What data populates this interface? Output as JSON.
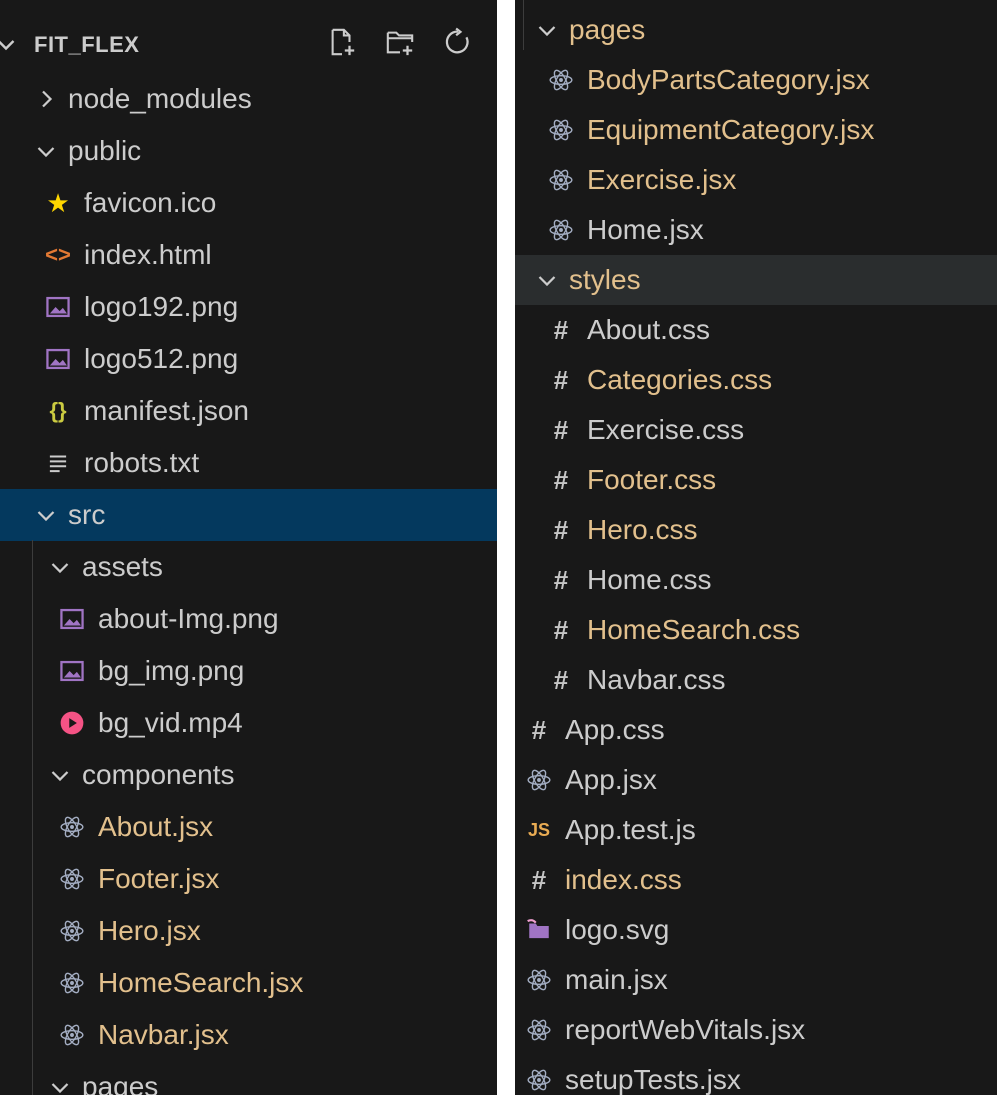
{
  "colors": {
    "background": "#181818",
    "text": "#cccccc",
    "modified": "#e2c08d",
    "selected": "#04395e",
    "hover": "#2a2d2e",
    "react": "#a3adc2",
    "hash": "#c5c5c5",
    "image": "#a074c4",
    "html": "#e37933",
    "json": "#cbcb41",
    "video": "#f55385",
    "js": "#e8ab53",
    "star": "#ffd700"
  },
  "explorer": {
    "root_title": "FIT_FLEX",
    "toolbar": [
      {
        "name": "new-file-button",
        "icon": "new-file-icon"
      },
      {
        "name": "new-folder-button",
        "icon": "new-folder-icon"
      },
      {
        "name": "refresh-explorer-button",
        "icon": "refresh-icon"
      }
    ],
    "left": [
      {
        "label": "node_modules",
        "kind": "folder",
        "expanded": false,
        "depth": 0
      },
      {
        "label": "public",
        "kind": "folder",
        "expanded": true,
        "depth": 0
      },
      {
        "label": "favicon.ico",
        "kind": "file",
        "icon": "star",
        "depth": 1
      },
      {
        "label": "index.html",
        "kind": "file",
        "icon": "html",
        "depth": 1
      },
      {
        "label": "logo192.png",
        "kind": "file",
        "icon": "image",
        "depth": 1
      },
      {
        "label": "logo512.png",
        "kind": "file",
        "icon": "image",
        "depth": 1
      },
      {
        "label": "manifest.json",
        "kind": "file",
        "icon": "json",
        "depth": 1
      },
      {
        "label": "robots.txt",
        "kind": "file",
        "icon": "text",
        "depth": 1
      },
      {
        "label": "src",
        "kind": "folder",
        "expanded": true,
        "depth": 0,
        "selected": true
      },
      {
        "label": "assets",
        "kind": "folder",
        "expanded": true,
        "depth": 1
      },
      {
        "label": "about-Img.png",
        "kind": "file",
        "icon": "image",
        "depth": 2
      },
      {
        "label": "bg_img.png",
        "kind": "file",
        "icon": "image",
        "depth": 2
      },
      {
        "label": "bg_vid.mp4",
        "kind": "file",
        "icon": "video",
        "depth": 2
      },
      {
        "label": "components",
        "kind": "folder",
        "expanded": true,
        "depth": 1
      },
      {
        "label": "About.jsx",
        "kind": "file",
        "icon": "react",
        "depth": 2,
        "modified": true
      },
      {
        "label": "Footer.jsx",
        "kind": "file",
        "icon": "react",
        "depth": 2,
        "modified": true
      },
      {
        "label": "Hero.jsx",
        "kind": "file",
        "icon": "react",
        "depth": 2,
        "modified": true
      },
      {
        "label": "HomeSearch.jsx",
        "kind": "file",
        "icon": "react",
        "depth": 2,
        "modified": true
      },
      {
        "label": "Navbar.jsx",
        "kind": "file",
        "icon": "react",
        "depth": 2,
        "modified": true
      },
      {
        "label": "pages",
        "kind": "folder",
        "expanded": true,
        "depth": 1
      }
    ],
    "right": [
      {
        "label": "pages",
        "kind": "folder",
        "expanded": true,
        "depth": 1,
        "modified": true
      },
      {
        "label": "BodyPartsCategory.jsx",
        "kind": "file",
        "icon": "react",
        "depth": 2,
        "modified": true
      },
      {
        "label": "EquipmentCategory.jsx",
        "kind": "file",
        "icon": "react",
        "depth": 2,
        "modified": true
      },
      {
        "label": "Exercise.jsx",
        "kind": "file",
        "icon": "react",
        "depth": 2,
        "modified": true
      },
      {
        "label": "Home.jsx",
        "kind": "file",
        "icon": "react",
        "depth": 2
      },
      {
        "label": "styles",
        "kind": "folder",
        "expanded": true,
        "depth": 1,
        "modified": true,
        "hover": true
      },
      {
        "label": "About.css",
        "kind": "file",
        "icon": "hash",
        "depth": 2
      },
      {
        "label": "Categories.css",
        "kind": "file",
        "icon": "hash",
        "depth": 2,
        "modified": true
      },
      {
        "label": "Exercise.css",
        "kind": "file",
        "icon": "hash",
        "depth": 2
      },
      {
        "label": "Footer.css",
        "kind": "file",
        "icon": "hash",
        "depth": 2,
        "modified": true
      },
      {
        "label": "Hero.css",
        "kind": "file",
        "icon": "hash",
        "depth": 2,
        "modified": true
      },
      {
        "label": "Home.css",
        "kind": "file",
        "icon": "hash",
        "depth": 2
      },
      {
        "label": "HomeSearch.css",
        "kind": "file",
        "icon": "hash",
        "depth": 2,
        "modified": true
      },
      {
        "label": "Navbar.css",
        "kind": "file",
        "icon": "hash",
        "depth": 2
      },
      {
        "label": "App.css",
        "kind": "file",
        "icon": "hash",
        "depth": 1
      },
      {
        "label": "App.jsx",
        "kind": "file",
        "icon": "react",
        "depth": 1
      },
      {
        "label": "App.test.js",
        "kind": "file",
        "icon": "js",
        "depth": 1
      },
      {
        "label": "index.css",
        "kind": "file",
        "icon": "hash",
        "depth": 1,
        "modified": true
      },
      {
        "label": "logo.svg",
        "kind": "file",
        "icon": "svg",
        "depth": 1
      },
      {
        "label": "main.jsx",
        "kind": "file",
        "icon": "react",
        "depth": 1
      },
      {
        "label": "reportWebVitals.jsx",
        "kind": "file",
        "icon": "react",
        "depth": 1
      },
      {
        "label": "setupTests.jsx",
        "kind": "file",
        "icon": "react",
        "depth": 1
      }
    ]
  }
}
